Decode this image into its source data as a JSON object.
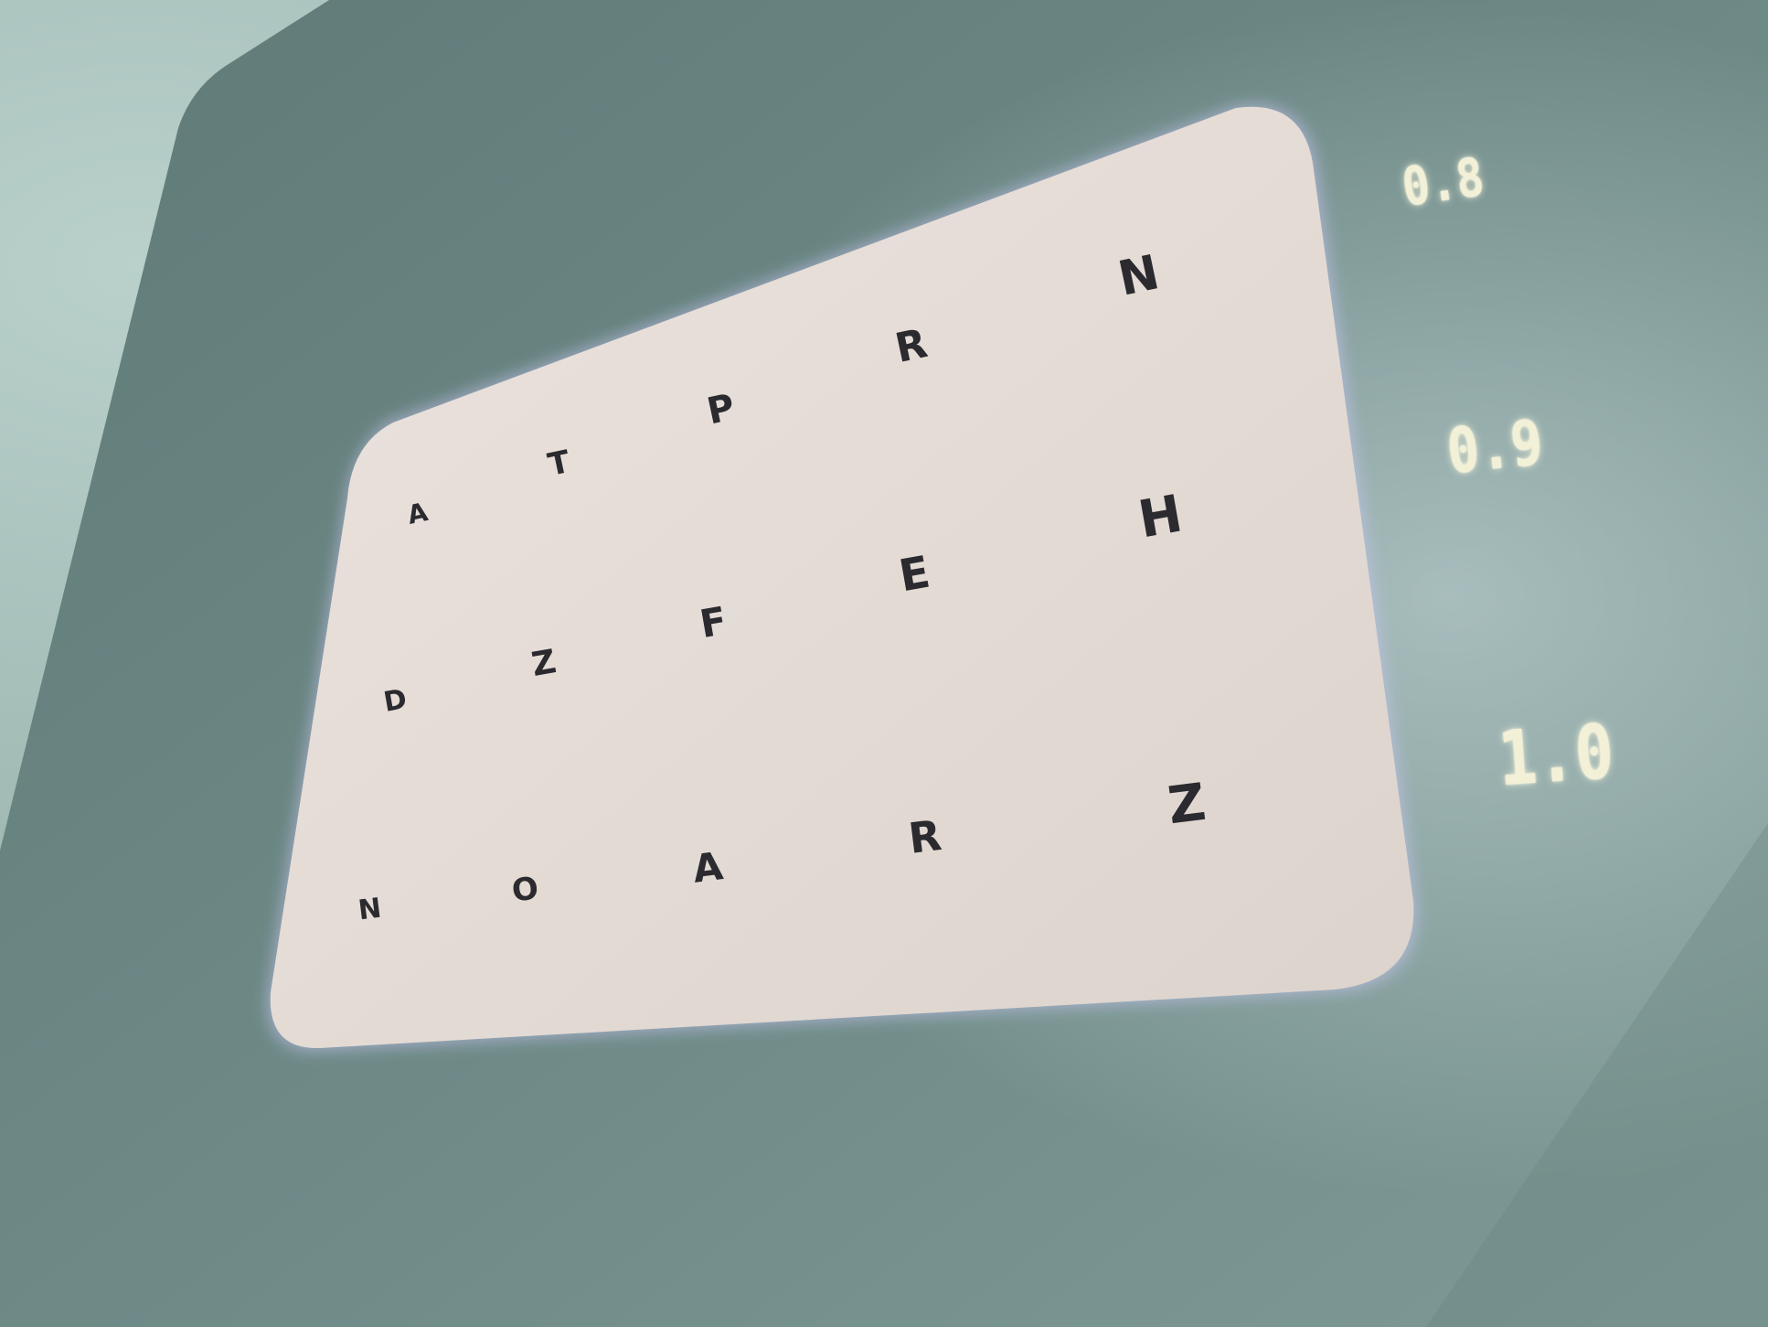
{
  "chart": {
    "rows": [
      {
        "letters": [
          "A",
          "T",
          "P",
          "R",
          "N"
        ],
        "acuity": "0.8"
      },
      {
        "letters": [
          "D",
          "Z",
          "F",
          "E",
          "H"
        ],
        "acuity": "0.9"
      },
      {
        "letters": [
          "N",
          "O",
          "A",
          "R",
          "Z"
        ],
        "acuity": "1.0"
      }
    ]
  },
  "colors": {
    "wall": "#6f8b88",
    "panel": "#e6dcd6",
    "letters": "#2a2a2f",
    "acuity_labels": "#f3f0d8"
  }
}
